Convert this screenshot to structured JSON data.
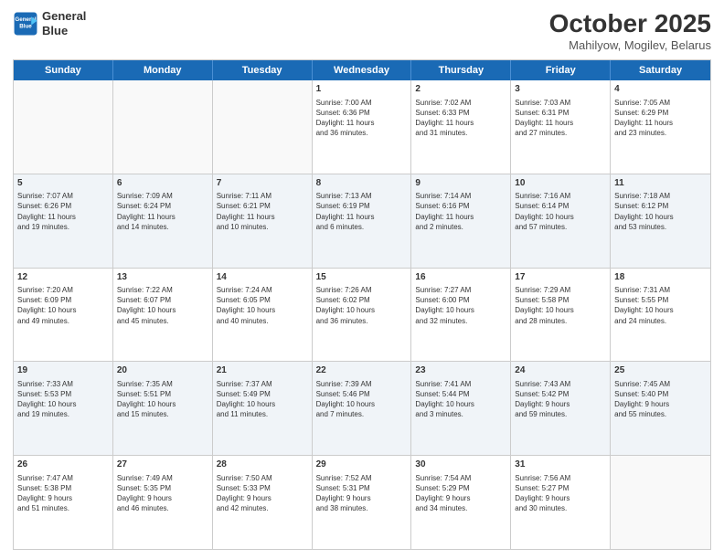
{
  "header": {
    "logo_line1": "General",
    "logo_line2": "Blue",
    "month_year": "October 2025",
    "location": "Mahilyow, Mogilev, Belarus"
  },
  "days": [
    "Sunday",
    "Monday",
    "Tuesday",
    "Wednesday",
    "Thursday",
    "Friday",
    "Saturday"
  ],
  "weeks": [
    [
      {
        "day": "",
        "info": ""
      },
      {
        "day": "",
        "info": ""
      },
      {
        "day": "",
        "info": ""
      },
      {
        "day": "1",
        "info": "Sunrise: 7:00 AM\nSunset: 6:36 PM\nDaylight: 11 hours\nand 36 minutes."
      },
      {
        "day": "2",
        "info": "Sunrise: 7:02 AM\nSunset: 6:33 PM\nDaylight: 11 hours\nand 31 minutes."
      },
      {
        "day": "3",
        "info": "Sunrise: 7:03 AM\nSunset: 6:31 PM\nDaylight: 11 hours\nand 27 minutes."
      },
      {
        "day": "4",
        "info": "Sunrise: 7:05 AM\nSunset: 6:29 PM\nDaylight: 11 hours\nand 23 minutes."
      }
    ],
    [
      {
        "day": "5",
        "info": "Sunrise: 7:07 AM\nSunset: 6:26 PM\nDaylight: 11 hours\nand 19 minutes."
      },
      {
        "day": "6",
        "info": "Sunrise: 7:09 AM\nSunset: 6:24 PM\nDaylight: 11 hours\nand 14 minutes."
      },
      {
        "day": "7",
        "info": "Sunrise: 7:11 AM\nSunset: 6:21 PM\nDaylight: 11 hours\nand 10 minutes."
      },
      {
        "day": "8",
        "info": "Sunrise: 7:13 AM\nSunset: 6:19 PM\nDaylight: 11 hours\nand 6 minutes."
      },
      {
        "day": "9",
        "info": "Sunrise: 7:14 AM\nSunset: 6:16 PM\nDaylight: 11 hours\nand 2 minutes."
      },
      {
        "day": "10",
        "info": "Sunrise: 7:16 AM\nSunset: 6:14 PM\nDaylight: 10 hours\nand 57 minutes."
      },
      {
        "day": "11",
        "info": "Sunrise: 7:18 AM\nSunset: 6:12 PM\nDaylight: 10 hours\nand 53 minutes."
      }
    ],
    [
      {
        "day": "12",
        "info": "Sunrise: 7:20 AM\nSunset: 6:09 PM\nDaylight: 10 hours\nand 49 minutes."
      },
      {
        "day": "13",
        "info": "Sunrise: 7:22 AM\nSunset: 6:07 PM\nDaylight: 10 hours\nand 45 minutes."
      },
      {
        "day": "14",
        "info": "Sunrise: 7:24 AM\nSunset: 6:05 PM\nDaylight: 10 hours\nand 40 minutes."
      },
      {
        "day": "15",
        "info": "Sunrise: 7:26 AM\nSunset: 6:02 PM\nDaylight: 10 hours\nand 36 minutes."
      },
      {
        "day": "16",
        "info": "Sunrise: 7:27 AM\nSunset: 6:00 PM\nDaylight: 10 hours\nand 32 minutes."
      },
      {
        "day": "17",
        "info": "Sunrise: 7:29 AM\nSunset: 5:58 PM\nDaylight: 10 hours\nand 28 minutes."
      },
      {
        "day": "18",
        "info": "Sunrise: 7:31 AM\nSunset: 5:55 PM\nDaylight: 10 hours\nand 24 minutes."
      }
    ],
    [
      {
        "day": "19",
        "info": "Sunrise: 7:33 AM\nSunset: 5:53 PM\nDaylight: 10 hours\nand 19 minutes."
      },
      {
        "day": "20",
        "info": "Sunrise: 7:35 AM\nSunset: 5:51 PM\nDaylight: 10 hours\nand 15 minutes."
      },
      {
        "day": "21",
        "info": "Sunrise: 7:37 AM\nSunset: 5:49 PM\nDaylight: 10 hours\nand 11 minutes."
      },
      {
        "day": "22",
        "info": "Sunrise: 7:39 AM\nSunset: 5:46 PM\nDaylight: 10 hours\nand 7 minutes."
      },
      {
        "day": "23",
        "info": "Sunrise: 7:41 AM\nSunset: 5:44 PM\nDaylight: 10 hours\nand 3 minutes."
      },
      {
        "day": "24",
        "info": "Sunrise: 7:43 AM\nSunset: 5:42 PM\nDaylight: 9 hours\nand 59 minutes."
      },
      {
        "day": "25",
        "info": "Sunrise: 7:45 AM\nSunset: 5:40 PM\nDaylight: 9 hours\nand 55 minutes."
      }
    ],
    [
      {
        "day": "26",
        "info": "Sunrise: 7:47 AM\nSunset: 5:38 PM\nDaylight: 9 hours\nand 51 minutes."
      },
      {
        "day": "27",
        "info": "Sunrise: 7:49 AM\nSunset: 5:35 PM\nDaylight: 9 hours\nand 46 minutes."
      },
      {
        "day": "28",
        "info": "Sunrise: 7:50 AM\nSunset: 5:33 PM\nDaylight: 9 hours\nand 42 minutes."
      },
      {
        "day": "29",
        "info": "Sunrise: 7:52 AM\nSunset: 5:31 PM\nDaylight: 9 hours\nand 38 minutes."
      },
      {
        "day": "30",
        "info": "Sunrise: 7:54 AM\nSunset: 5:29 PM\nDaylight: 9 hours\nand 34 minutes."
      },
      {
        "day": "31",
        "info": "Sunrise: 7:56 AM\nSunset: 5:27 PM\nDaylight: 9 hours\nand 30 minutes."
      },
      {
        "day": "",
        "info": ""
      }
    ]
  ]
}
